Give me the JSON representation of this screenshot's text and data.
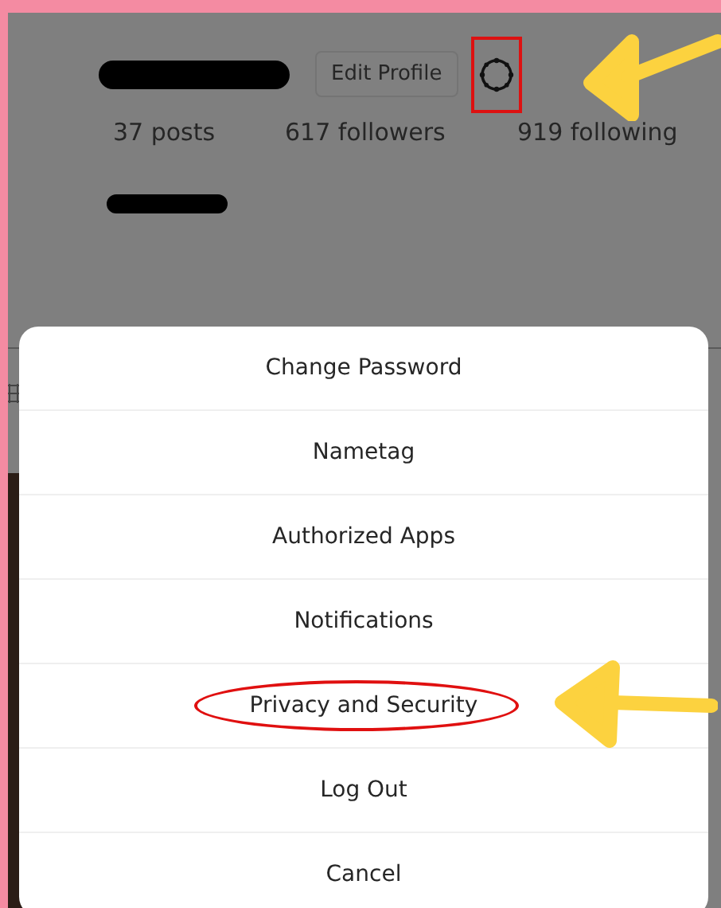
{
  "profile": {
    "edit_button": "Edit Profile",
    "stats": [
      "37 posts",
      "617 followers",
      "919 following"
    ]
  },
  "menu": {
    "items": [
      {
        "label": "Change Password",
        "circled": false
      },
      {
        "label": "Nametag",
        "circled": false
      },
      {
        "label": "Authorized Apps",
        "circled": false
      },
      {
        "label": "Notifications",
        "circled": false
      },
      {
        "label": "Privacy and Security",
        "circled": true
      },
      {
        "label": "Log Out",
        "circled": false
      },
      {
        "label": "Cancel",
        "circled": false
      }
    ]
  }
}
